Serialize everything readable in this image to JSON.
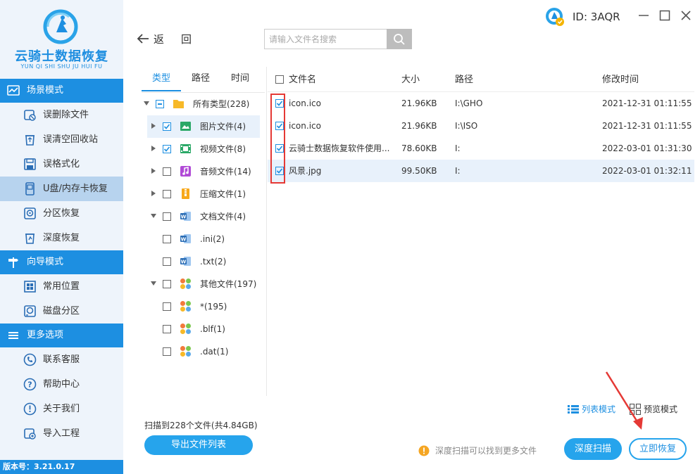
{
  "app": {
    "logo_title": "云骑士数据恢复",
    "logo_subtitle": "YUN QI SHI SHU JU HUI FU",
    "version": "版本号：3.21.0.17",
    "user_id": "ID: 3AQR",
    "accent_color": "#1d8fe1"
  },
  "sidebar": {
    "sections": [
      {
        "title": "场景模式",
        "items": [
          {
            "label": "误删除文件",
            "icon": "delete-file-icon"
          },
          {
            "label": "误清空回收站",
            "icon": "recycle-bin-icon"
          },
          {
            "label": "误格式化",
            "icon": "format-disk-icon"
          },
          {
            "label": "U盘/内存卡恢复",
            "icon": "usb-drive-icon",
            "active": true
          },
          {
            "label": "分区恢复",
            "icon": "partition-icon"
          },
          {
            "label": "深度恢复",
            "icon": "deep-recovery-icon"
          }
        ]
      },
      {
        "title": "向导模式",
        "items": [
          {
            "label": "常用位置",
            "icon": "windows-icon"
          },
          {
            "label": "磁盘分区",
            "icon": "disk-partition-icon"
          }
        ]
      },
      {
        "title": "更多选项",
        "items": [
          {
            "label": "联系客服",
            "icon": "phone-icon"
          },
          {
            "label": "帮助中心",
            "icon": "help-icon"
          },
          {
            "label": "关于我们",
            "icon": "info-icon"
          },
          {
            "label": "导入工程",
            "icon": "import-icon"
          }
        ]
      }
    ]
  },
  "toolbar": {
    "back_label": "返回",
    "search_placeholder": "请输入文件名搜索"
  },
  "category_tabs": [
    "类型",
    "路径",
    "时间"
  ],
  "tree": [
    {
      "label": "所有类型(228)",
      "level": 0,
      "expanded": true,
      "state": "partial",
      "icon": "folder-icon"
    },
    {
      "label": "图片文件(4)",
      "level": 1,
      "expanded": false,
      "state": "checked",
      "icon": "image-file-icon",
      "selected": true
    },
    {
      "label": "视频文件(8)",
      "level": 1,
      "expanded": false,
      "state": "checked",
      "icon": "video-file-icon"
    },
    {
      "label": "音频文件(14)",
      "level": 1,
      "expanded": false,
      "state": "unchecked",
      "icon": "audio-file-icon"
    },
    {
      "label": "压缩文件(1)",
      "level": 1,
      "expanded": false,
      "state": "unchecked",
      "icon": "archive-file-icon"
    },
    {
      "label": "文档文件(4)",
      "level": 1,
      "expanded": true,
      "state": "unchecked",
      "icon": "document-file-icon"
    },
    {
      "label": ".ini(2)",
      "level": 2,
      "state": "unchecked",
      "icon": "document-file-icon"
    },
    {
      "label": ".txt(2)",
      "level": 2,
      "state": "unchecked",
      "icon": "document-file-icon"
    },
    {
      "label": "其他文件(197)",
      "level": 1,
      "expanded": true,
      "state": "unchecked",
      "icon": "other-file-icon"
    },
    {
      "label": "*(195)",
      "level": 2,
      "state": "unchecked",
      "icon": "other-file-icon"
    },
    {
      "label": ".blf(1)",
      "level": 2,
      "state": "unchecked",
      "icon": "other-file-icon"
    },
    {
      "label": ".dat(1)",
      "level": 2,
      "state": "unchecked",
      "icon": "other-file-icon"
    }
  ],
  "scan_summary": "扫描到228个文件(共4.84GB)",
  "export_label": "导出文件列表",
  "table": {
    "headers": {
      "name": "文件名",
      "size": "大小",
      "path": "路径",
      "time": "修改时间"
    },
    "rows": [
      {
        "name": "icon.ico",
        "size": "21.96KB",
        "path": "I:\\GHO",
        "time": "2021-12-31 01:11:55"
      },
      {
        "name": "icon.ico",
        "size": "21.96KB",
        "path": "I:\\ISO",
        "time": "2021-12-31 01:11:55"
      },
      {
        "name": "云骑士数据恢复软件使用...",
        "size": "78.60KB",
        "path": "I:",
        "time": "2022-03-01 01:31:30"
      },
      {
        "name": "风景.jpg",
        "size": "99.50KB",
        "path": "I:",
        "time": "2022-03-01 01:32:11",
        "highlight": true
      }
    ]
  },
  "view_modes": {
    "list": "列表模式",
    "preview": "预览模式"
  },
  "tip": "深度扫描可以找到更多文件",
  "deep_scan_label": "深度扫描",
  "recover_label": "立即恢复"
}
